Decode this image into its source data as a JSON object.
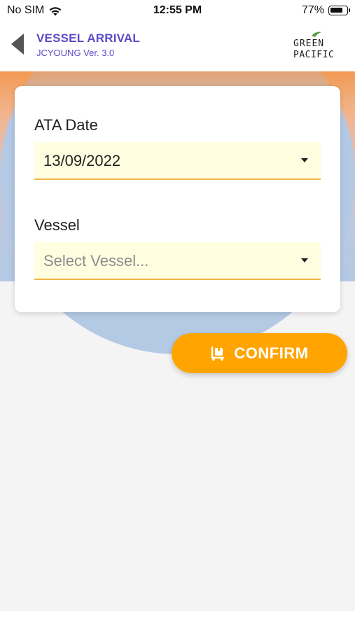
{
  "status_bar": {
    "carrier": "No SIM",
    "time": "12:55 PM",
    "battery": "77%",
    "battery_level": 0.77
  },
  "header": {
    "title": "VESSEL ARRIVAL",
    "subtitle": "JCYOUNG Ver. 3.0",
    "logo_line1": "GREEN",
    "logo_line2": "PACIFIC"
  },
  "form": {
    "ata_date": {
      "label": "ATA Date",
      "value": "13/09/2022"
    },
    "vessel": {
      "label": "Vessel",
      "placeholder": "Select Vessel..."
    }
  },
  "actions": {
    "confirm_label": "CONFIRM"
  },
  "colors": {
    "accent": "#ffa400",
    "title": "#5b4cc4",
    "field_bg": "#fffee0",
    "field_underline": "#f0b54a"
  },
  "icons": {
    "back": "back-arrow-icon",
    "wifi": "wifi-icon",
    "battery": "battery-icon",
    "caret": "dropdown-caret-icon",
    "confirm": "cargo-dolly-icon"
  }
}
